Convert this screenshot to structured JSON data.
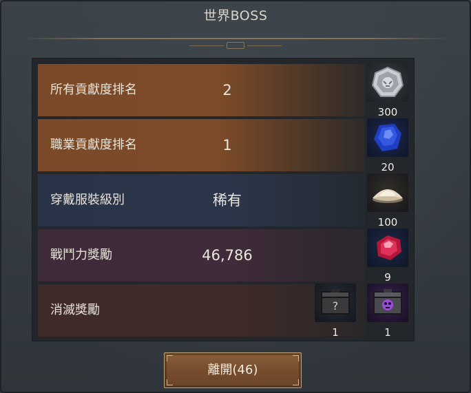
{
  "window": {
    "title": "世界BOSS"
  },
  "rows": [
    {
      "label": "所有貢獻度排名",
      "value": "2"
    },
    {
      "label": "職業貢獻度排名",
      "value": "1"
    },
    {
      "label": "穿戴服裝級別",
      "value": "稀有"
    },
    {
      "label": "戰鬥力獎勵",
      "value": "46,786"
    },
    {
      "label": "消滅獎勵",
      "value": ""
    }
  ],
  "rewards": [
    {
      "icon": "silver-tiger-medal-icon",
      "count": "300"
    },
    {
      "icon": "blue-gem-icon",
      "count": "20"
    },
    {
      "icon": "powder-pile-icon",
      "count": "100"
    },
    {
      "icon": "red-gem-icon",
      "count": "9"
    }
  ],
  "kill_rewards": [
    {
      "icon": "mystery-chest-icon",
      "count": "1"
    },
    {
      "icon": "purple-skull-chest-icon",
      "count": "1"
    }
  ],
  "leave_button": {
    "label": "離開(46)"
  },
  "colors": {
    "brown_row": "#7a4a28",
    "blue_row": "#2a3448",
    "purple_row": "#3e2a38",
    "button": "#764d2d"
  }
}
